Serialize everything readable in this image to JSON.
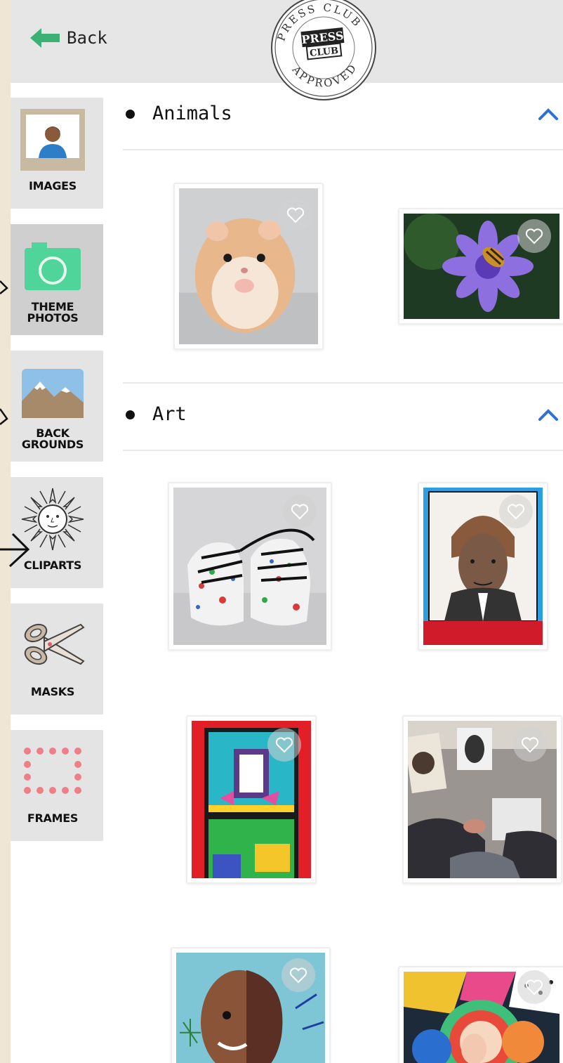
{
  "header": {
    "back_label": "Back",
    "stamp": {
      "top_text": "PRESS CLUB",
      "bottom_text": "APPROVED",
      "center_line1": "PRESS",
      "center_line2": "CLUB"
    }
  },
  "sidebar": {
    "items": [
      {
        "label": "IMAGES",
        "icon": "portrait-icon"
      },
      {
        "label": "THEME\nPHOTOS",
        "icon": "camera-icon",
        "active": true
      },
      {
        "label": "BACK\nGROUNDS",
        "icon": "mountain-icon"
      },
      {
        "label": "CLIPARTS",
        "icon": "sun-icon"
      },
      {
        "label": "MASKS",
        "icon": "scissors-icon"
      },
      {
        "label": "FRAMES",
        "icon": "frame-icon"
      }
    ]
  },
  "sections": [
    {
      "title": "Animals",
      "expanded": true
    },
    {
      "title": "Art",
      "expanded": true
    }
  ],
  "colors": {
    "back_arrow": "#3bb273",
    "chevron": "#2f6fd6",
    "camera": "#4fd49a",
    "frame_dots": "#ef7f86"
  }
}
